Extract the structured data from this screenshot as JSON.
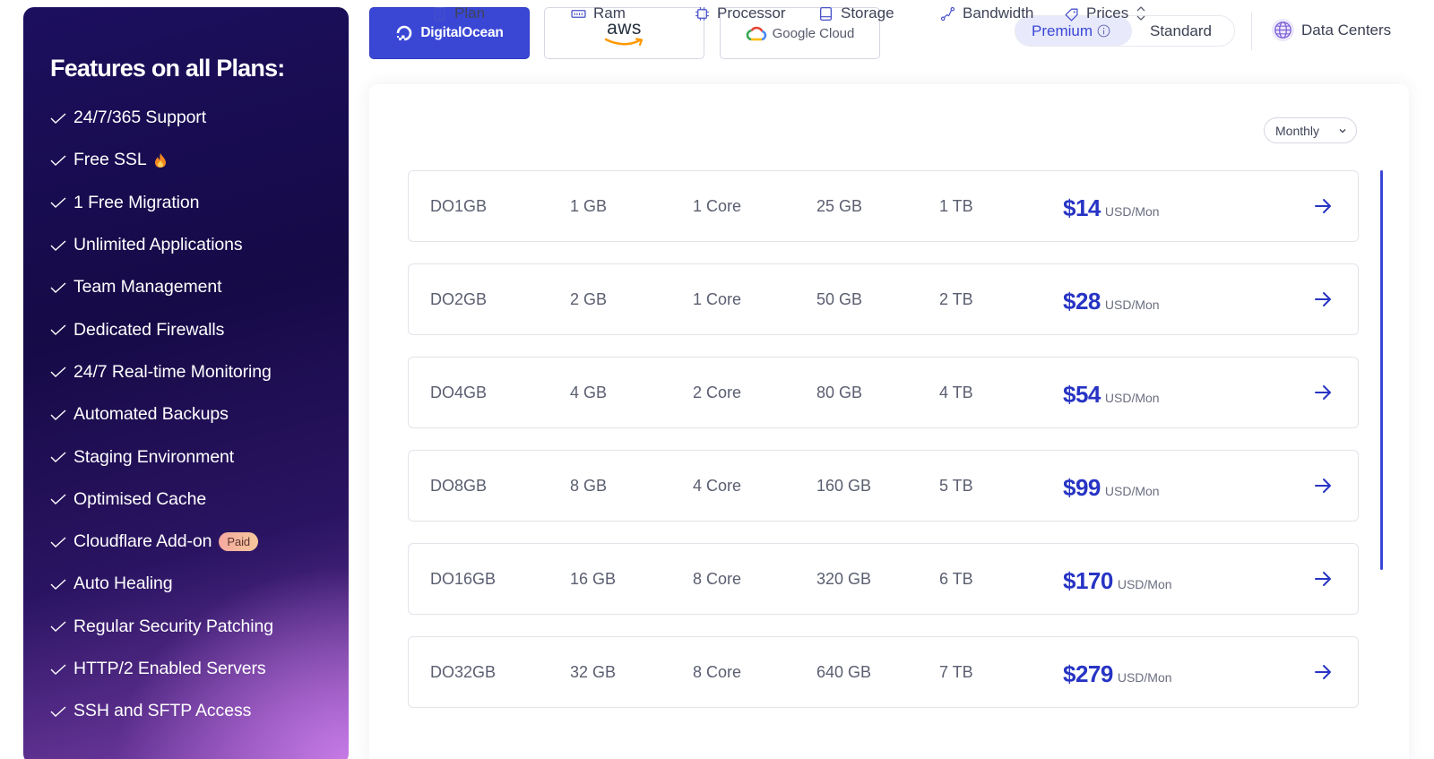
{
  "sidebar": {
    "title": "Features on all Plans:",
    "features": [
      {
        "label": "24/7/365 Support"
      },
      {
        "label": "Free SSL"
      },
      {
        "label": "1 Free Migration"
      },
      {
        "label": "Unlimited Applications"
      },
      {
        "label": "Team Management"
      },
      {
        "label": "Dedicated Firewalls"
      },
      {
        "label": "24/7 Real-time Monitoring"
      },
      {
        "label": "Automated Backups"
      },
      {
        "label": "Staging Environment"
      },
      {
        "label": "Optimised Cache"
      },
      {
        "label": "Cloudflare Add-on"
      },
      {
        "label": "Auto Healing"
      },
      {
        "label": "Regular Security Patching"
      },
      {
        "label": "HTTP/2 Enabled Servers"
      },
      {
        "label": "SSH and SFTP Access"
      }
    ],
    "paid_badge": "Paid"
  },
  "providers": [
    {
      "label": "DigitalOcean",
      "active": true
    },
    {
      "label": "aws",
      "active": false
    },
    {
      "label": "Google Cloud",
      "active": false
    }
  ],
  "tiers": {
    "premium": "Premium",
    "standard": "Standard",
    "selected": "Premium"
  },
  "data_centers_label": "Data Centers",
  "table": {
    "headers": {
      "plan": "Plan",
      "ram": "Ram",
      "processor": "Processor",
      "storage": "Storage",
      "bandwidth": "Bandwidth",
      "prices": "Prices"
    },
    "billing": "Monthly",
    "rows": [
      {
        "plan": "DO1GB",
        "ram": "1 GB",
        "processor": "1 Core",
        "storage": "25 GB",
        "bandwidth": "1 TB",
        "price": "$14",
        "unit": "USD/Mon"
      },
      {
        "plan": "DO2GB",
        "ram": "2 GB",
        "processor": "1 Core",
        "storage": "50 GB",
        "bandwidth": "2 TB",
        "price": "$28",
        "unit": "USD/Mon"
      },
      {
        "plan": "DO4GB",
        "ram": "4 GB",
        "processor": "2 Core",
        "storage": "80 GB",
        "bandwidth": "4 TB",
        "price": "$54",
        "unit": "USD/Mon"
      },
      {
        "plan": "DO8GB",
        "ram": "8 GB",
        "processor": "4 Core",
        "storage": "160 GB",
        "bandwidth": "5 TB",
        "price": "$99",
        "unit": "USD/Mon"
      },
      {
        "plan": "DO16GB",
        "ram": "16 GB",
        "processor": "8 Core",
        "storage": "320 GB",
        "bandwidth": "6 TB",
        "price": "$170",
        "unit": "USD/Mon"
      },
      {
        "plan": "DO32GB",
        "ram": "32 GB",
        "processor": "8 Core",
        "storage": "640 GB",
        "bandwidth": "7 TB",
        "price": "$279",
        "unit": "USD/Mon"
      }
    ]
  },
  "colors": {
    "accent": "#3a47d5",
    "price": "#2734c4",
    "sidebar_dark": "#160a47",
    "sidebar_glow": "#c77be6"
  },
  "icons": {
    "feature": "check-icon",
    "free_ssl": "fire-icon",
    "row_action": "arrow-right-icon"
  }
}
